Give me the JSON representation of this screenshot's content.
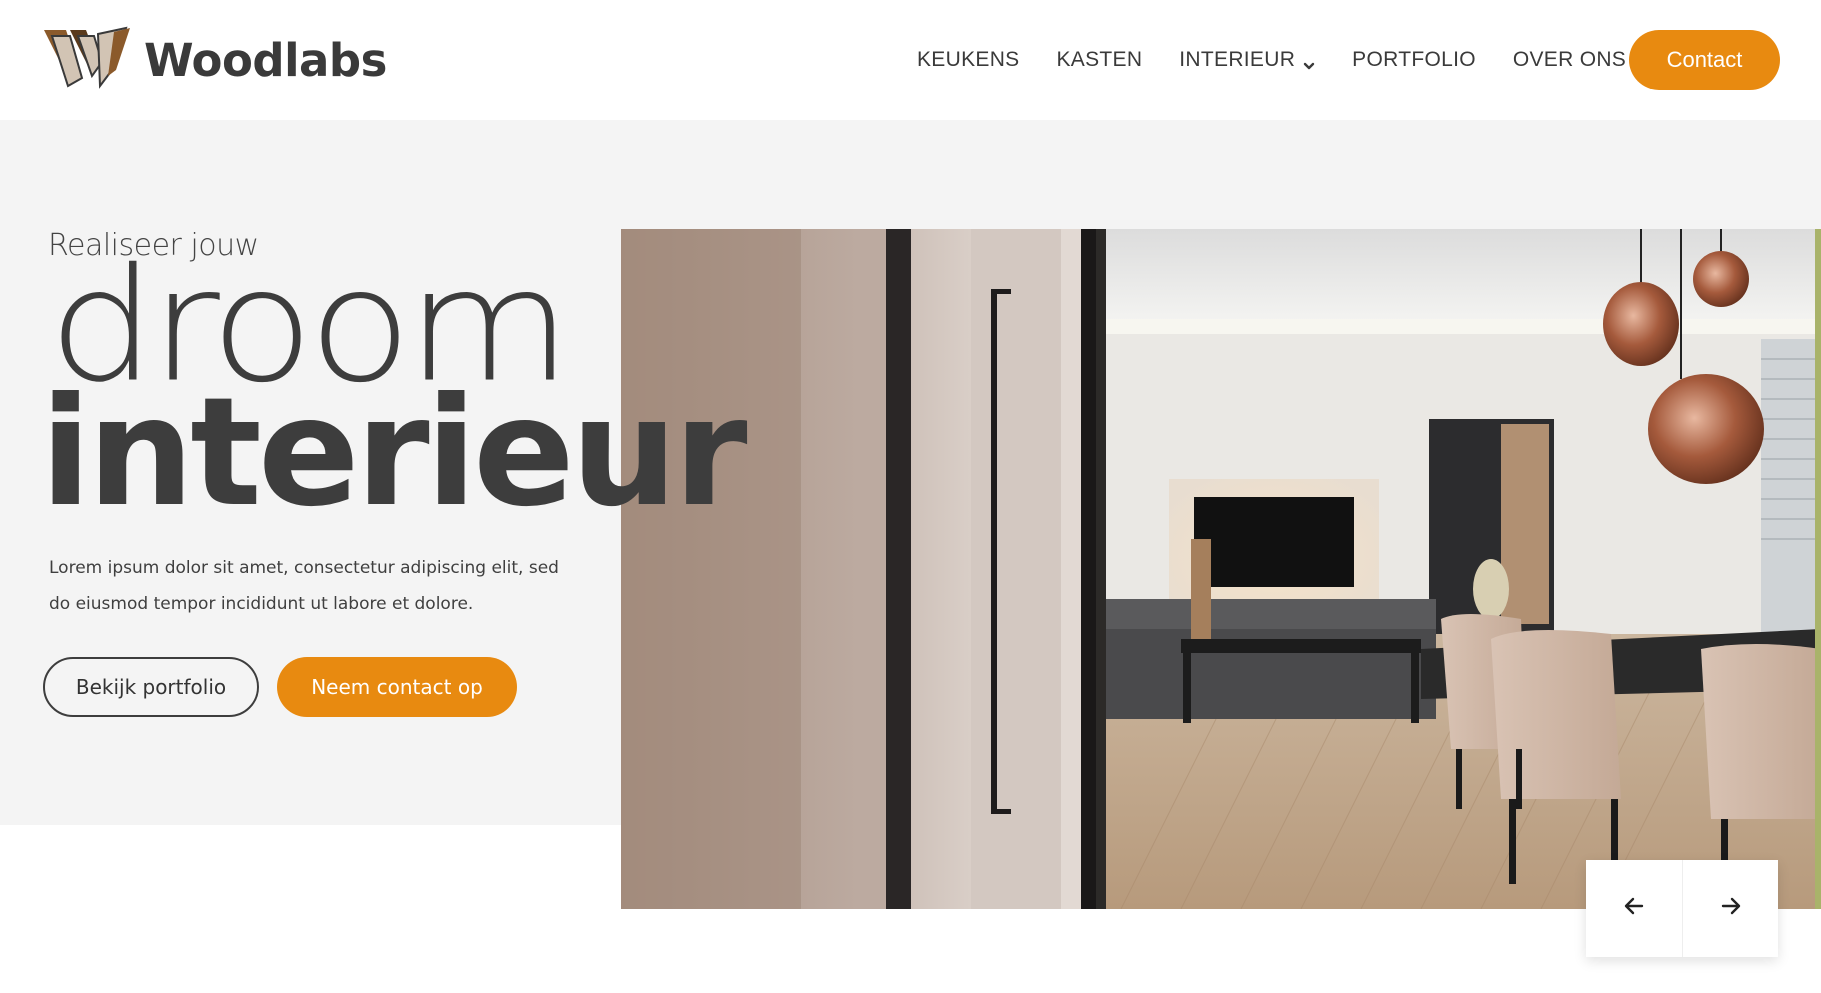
{
  "brand": {
    "name": "Woodlabs",
    "logo_icon": "woodlabs-w-logo-icon",
    "colors": {
      "accent": "#e88a10",
      "text": "#3d3d3d",
      "hero_bg": "#f4f4f4",
      "logo_brown": "#8b5a2b",
      "logo_beige": "#d2c4b4"
    }
  },
  "nav": {
    "items": [
      {
        "label": "KEUKENS",
        "has_dropdown": false
      },
      {
        "label": "KASTEN",
        "has_dropdown": false
      },
      {
        "label": "INTERIEUR",
        "has_dropdown": true
      },
      {
        "label": "PORTFOLIO",
        "has_dropdown": false
      },
      {
        "label": "OVER ONS",
        "has_dropdown": true
      }
    ],
    "dropdown_icon": "chevron-down-icon",
    "contact_label": "Contact"
  },
  "hero": {
    "kicker": "Realiseer jouw",
    "headline_light": "droom",
    "headline_bold": "interieur",
    "lead": "Lorem ipsum dolor sit amet, consectetur adipiscing elit, sed do eiusmod tempor incididunt ut labore et dolore.",
    "buttons": {
      "portfolio": "Bekijk portfolio",
      "contact": "Neem contact op"
    },
    "image": "interior-living-dining-photo"
  },
  "slider": {
    "prev_icon": "arrow-left-icon",
    "next_icon": "arrow-right-icon"
  }
}
